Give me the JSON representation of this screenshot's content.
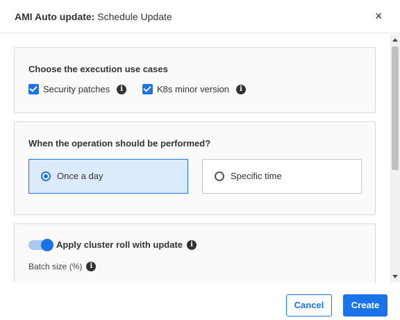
{
  "modal": {
    "title_bold": "AMI Auto update:",
    "title_rest": "Schedule Update",
    "close_symbol": "×"
  },
  "use_cases": {
    "title": "Choose the execution use cases",
    "options": [
      {
        "label": "Security patches",
        "checked": true
      },
      {
        "label": "K8s minor version",
        "checked": true
      }
    ]
  },
  "operation": {
    "title": "When the operation should be performed?",
    "options": [
      {
        "label": "Once a day",
        "selected": true
      },
      {
        "label": "Specific time",
        "selected": false
      }
    ]
  },
  "cluster_roll": {
    "toggle_label": "Apply cluster roll with update",
    "toggle_on": true,
    "batch_label": "Batch size (%)"
  },
  "footer": {
    "cancel_label": "Cancel",
    "create_label": "Create"
  },
  "icons": {
    "info": "info-icon",
    "close": "close-icon",
    "check": "checkmark-icon"
  },
  "colors": {
    "accent": "#1a73e8",
    "selected_bg": "#dcebfc",
    "toggle_track": "#a9c9f3",
    "card_bg": "#fafafa"
  }
}
